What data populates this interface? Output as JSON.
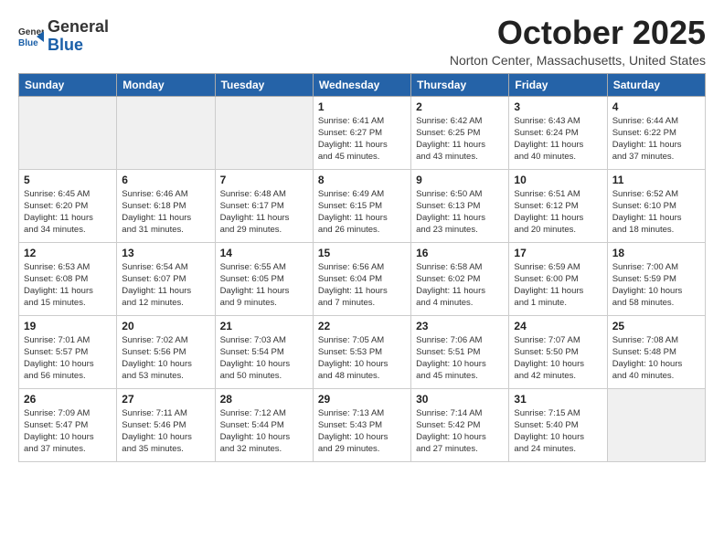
{
  "header": {
    "logo": {
      "line1": "General",
      "line2": "Blue"
    },
    "title": "October 2025",
    "location": "Norton Center, Massachusetts, United States"
  },
  "weekdays": [
    "Sunday",
    "Monday",
    "Tuesday",
    "Wednesday",
    "Thursday",
    "Friday",
    "Saturday"
  ],
  "weeks": [
    [
      {
        "day": "",
        "info": ""
      },
      {
        "day": "",
        "info": ""
      },
      {
        "day": "",
        "info": ""
      },
      {
        "day": "1",
        "info": "Sunrise: 6:41 AM\nSunset: 6:27 PM\nDaylight: 11 hours\nand 45 minutes."
      },
      {
        "day": "2",
        "info": "Sunrise: 6:42 AM\nSunset: 6:25 PM\nDaylight: 11 hours\nand 43 minutes."
      },
      {
        "day": "3",
        "info": "Sunrise: 6:43 AM\nSunset: 6:24 PM\nDaylight: 11 hours\nand 40 minutes."
      },
      {
        "day": "4",
        "info": "Sunrise: 6:44 AM\nSunset: 6:22 PM\nDaylight: 11 hours\nand 37 minutes."
      }
    ],
    [
      {
        "day": "5",
        "info": "Sunrise: 6:45 AM\nSunset: 6:20 PM\nDaylight: 11 hours\nand 34 minutes."
      },
      {
        "day": "6",
        "info": "Sunrise: 6:46 AM\nSunset: 6:18 PM\nDaylight: 11 hours\nand 31 minutes."
      },
      {
        "day": "7",
        "info": "Sunrise: 6:48 AM\nSunset: 6:17 PM\nDaylight: 11 hours\nand 29 minutes."
      },
      {
        "day": "8",
        "info": "Sunrise: 6:49 AM\nSunset: 6:15 PM\nDaylight: 11 hours\nand 26 minutes."
      },
      {
        "day": "9",
        "info": "Sunrise: 6:50 AM\nSunset: 6:13 PM\nDaylight: 11 hours\nand 23 minutes."
      },
      {
        "day": "10",
        "info": "Sunrise: 6:51 AM\nSunset: 6:12 PM\nDaylight: 11 hours\nand 20 minutes."
      },
      {
        "day": "11",
        "info": "Sunrise: 6:52 AM\nSunset: 6:10 PM\nDaylight: 11 hours\nand 18 minutes."
      }
    ],
    [
      {
        "day": "12",
        "info": "Sunrise: 6:53 AM\nSunset: 6:08 PM\nDaylight: 11 hours\nand 15 minutes."
      },
      {
        "day": "13",
        "info": "Sunrise: 6:54 AM\nSunset: 6:07 PM\nDaylight: 11 hours\nand 12 minutes."
      },
      {
        "day": "14",
        "info": "Sunrise: 6:55 AM\nSunset: 6:05 PM\nDaylight: 11 hours\nand 9 minutes."
      },
      {
        "day": "15",
        "info": "Sunrise: 6:56 AM\nSunset: 6:04 PM\nDaylight: 11 hours\nand 7 minutes."
      },
      {
        "day": "16",
        "info": "Sunrise: 6:58 AM\nSunset: 6:02 PM\nDaylight: 11 hours\nand 4 minutes."
      },
      {
        "day": "17",
        "info": "Sunrise: 6:59 AM\nSunset: 6:00 PM\nDaylight: 11 hours\nand 1 minute."
      },
      {
        "day": "18",
        "info": "Sunrise: 7:00 AM\nSunset: 5:59 PM\nDaylight: 10 hours\nand 58 minutes."
      }
    ],
    [
      {
        "day": "19",
        "info": "Sunrise: 7:01 AM\nSunset: 5:57 PM\nDaylight: 10 hours\nand 56 minutes."
      },
      {
        "day": "20",
        "info": "Sunrise: 7:02 AM\nSunset: 5:56 PM\nDaylight: 10 hours\nand 53 minutes."
      },
      {
        "day": "21",
        "info": "Sunrise: 7:03 AM\nSunset: 5:54 PM\nDaylight: 10 hours\nand 50 minutes."
      },
      {
        "day": "22",
        "info": "Sunrise: 7:05 AM\nSunset: 5:53 PM\nDaylight: 10 hours\nand 48 minutes."
      },
      {
        "day": "23",
        "info": "Sunrise: 7:06 AM\nSunset: 5:51 PM\nDaylight: 10 hours\nand 45 minutes."
      },
      {
        "day": "24",
        "info": "Sunrise: 7:07 AM\nSunset: 5:50 PM\nDaylight: 10 hours\nand 42 minutes."
      },
      {
        "day": "25",
        "info": "Sunrise: 7:08 AM\nSunset: 5:48 PM\nDaylight: 10 hours\nand 40 minutes."
      }
    ],
    [
      {
        "day": "26",
        "info": "Sunrise: 7:09 AM\nSunset: 5:47 PM\nDaylight: 10 hours\nand 37 minutes."
      },
      {
        "day": "27",
        "info": "Sunrise: 7:11 AM\nSunset: 5:46 PM\nDaylight: 10 hours\nand 35 minutes."
      },
      {
        "day": "28",
        "info": "Sunrise: 7:12 AM\nSunset: 5:44 PM\nDaylight: 10 hours\nand 32 minutes."
      },
      {
        "day": "29",
        "info": "Sunrise: 7:13 AM\nSunset: 5:43 PM\nDaylight: 10 hours\nand 29 minutes."
      },
      {
        "day": "30",
        "info": "Sunrise: 7:14 AM\nSunset: 5:42 PM\nDaylight: 10 hours\nand 27 minutes."
      },
      {
        "day": "31",
        "info": "Sunrise: 7:15 AM\nSunset: 5:40 PM\nDaylight: 10 hours\nand 24 minutes."
      },
      {
        "day": "",
        "info": ""
      }
    ]
  ]
}
